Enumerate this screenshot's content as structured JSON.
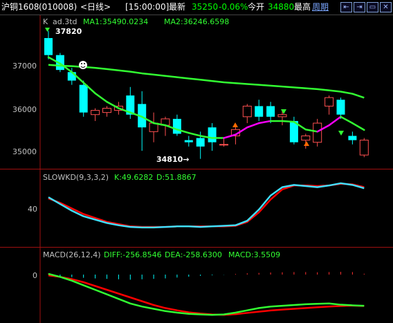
{
  "titlebar": {
    "instrument": "沪铜1608",
    "code": "(010008)",
    "period": "<日线>",
    "time": "[15:00:00]",
    "latest_label": "最新",
    "latest_value": "35250",
    "change_pct": "-0.06%",
    "open_label": "今开",
    "open_value": "34880",
    "high_label": "最高",
    "period_link": "周期",
    "buttons": [
      "⇤",
      "⇥",
      "▭",
      "✕"
    ]
  },
  "main_panel": {
    "header_k": "K",
    "header_ad": "ad.3td",
    "ma1_label": "MA1:35490.0234",
    "ma2_label": "MA2:36246.6598",
    "y_ticks": [
      "37000",
      "36000",
      "35000"
    ],
    "high_annotation": "37820",
    "low_annotation": "34810→",
    "colors": {
      "up": "#ff5050",
      "down": "#00ffff",
      "ma1": "#ff00ff",
      "ma2": "#32ff32"
    }
  },
  "kd_panel": {
    "title": "SLOWKD(9,3,3,2)",
    "k_label": "K:49.6282",
    "d_label": "D:51.8867",
    "y_tick": "40"
  },
  "macd_panel": {
    "title": "MACD(26,12,4)",
    "diff_label": "DIFF:-256.8546",
    "dea_label": "DEA:-258.6300",
    "macd_label": "MACD:3.5509",
    "y_tick": "0"
  },
  "chart_data": [
    {
      "type": "candlestick",
      "y_ticks": [
        37000,
        36000,
        35000
      ],
      "annotations": {
        "high": 37820,
        "low": 34810
      },
      "candles": [
        {
          "o": 37650,
          "h": 37820,
          "l": 37150,
          "c": 37250
        },
        {
          "o": 37250,
          "h": 37300,
          "l": 36850,
          "c": 36900
        },
        {
          "o": 36850,
          "h": 36950,
          "l": 36550,
          "c": 36650
        },
        {
          "o": 36550,
          "h": 36650,
          "l": 35800,
          "c": 35900
        },
        {
          "o": 35850,
          "h": 36000,
          "l": 35700,
          "c": 35950
        },
        {
          "o": 35900,
          "h": 36050,
          "l": 35800,
          "c": 36000
        },
        {
          "o": 35950,
          "h": 36150,
          "l": 35850,
          "c": 36050
        },
        {
          "o": 36300,
          "h": 36500,
          "l": 35750,
          "c": 35850
        },
        {
          "o": 36100,
          "h": 36400,
          "l": 35000,
          "c": 35550
        },
        {
          "o": 35450,
          "h": 35900,
          "l": 35200,
          "c": 35650
        },
        {
          "o": 35600,
          "h": 35800,
          "l": 35350,
          "c": 35750
        },
        {
          "o": 35750,
          "h": 35850,
          "l": 35350,
          "c": 35400
        },
        {
          "o": 35250,
          "h": 35350,
          "l": 35100,
          "c": 35200
        },
        {
          "o": 35300,
          "h": 35450,
          "l": 34810,
          "c": 35100
        },
        {
          "o": 35550,
          "h": 35650,
          "l": 35000,
          "c": 35200
        },
        {
          "o": 35150,
          "h": 35300,
          "l": 35100,
          "c": 35150
        },
        {
          "o": 35350,
          "h": 35600,
          "l": 35150,
          "c": 35500
        },
        {
          "o": 35800,
          "h": 36100,
          "l": 35650,
          "c": 36050
        },
        {
          "o": 36050,
          "h": 36200,
          "l": 35700,
          "c": 35800
        },
        {
          "o": 36050,
          "h": 36150,
          "l": 35650,
          "c": 35800
        },
        {
          "o": 35800,
          "h": 35950,
          "l": 35600,
          "c": 35850
        },
        {
          "o": 35700,
          "h": 35800,
          "l": 35150,
          "c": 35200
        },
        {
          "o": 35250,
          "h": 35400,
          "l": 35050,
          "c": 35350
        },
        {
          "o": 35200,
          "h": 35750,
          "l": 35100,
          "c": 35650
        },
        {
          "o": 36050,
          "h": 36300,
          "l": 35850,
          "c": 36250
        },
        {
          "o": 36200,
          "h": 36250,
          "l": 35750,
          "c": 35850
        },
        {
          "o": 35350,
          "h": 35450,
          "l": 35150,
          "c": 35250
        },
        {
          "o": 34900,
          "h": 35300,
          "l": 34850,
          "c": 35250
        }
      ],
      "ma1": [
        37200,
        37050,
        36850,
        36600,
        36350,
        36150,
        36000,
        35900,
        35800,
        35650,
        35600,
        35500,
        35420,
        35350,
        35300,
        35300,
        35380,
        35550,
        35650,
        35700,
        35700,
        35680,
        35500,
        35450,
        35600,
        35800,
        35650,
        35490
      ],
      "ma2": [
        37020,
        37000,
        36990,
        36970,
        36950,
        36920,
        36890,
        36860,
        36820,
        36790,
        36760,
        36730,
        36700,
        36670,
        36640,
        36610,
        36590,
        36570,
        36550,
        36530,
        36510,
        36490,
        36470,
        36450,
        36420,
        36390,
        36340,
        36247
      ]
    },
    {
      "type": "line",
      "y_ticks": [
        40
      ],
      "series": [
        {
          "name": "K",
          "values": [
            62,
            50,
            38,
            28,
            22,
            16,
            12,
            9,
            8,
            8,
            9,
            10,
            10,
            9,
            10,
            11,
            12,
            20,
            40,
            65,
            80,
            84,
            82,
            80,
            83,
            87,
            84,
            78
          ]
        },
        {
          "name": "D",
          "values": [
            60,
            52,
            42,
            32,
            25,
            18,
            14,
            10,
            9,
            9,
            9,
            10,
            10,
            10,
            10,
            10,
            11,
            18,
            35,
            58,
            76,
            83,
            83,
            82,
            83,
            86,
            85,
            80
          ]
        }
      ]
    },
    {
      "type": "bar+line",
      "y_ticks": [
        0
      ],
      "macd": [
        5,
        -8,
        -12,
        -15,
        -18,
        -20,
        -22,
        -24,
        -22,
        -20,
        -18,
        -14,
        -10,
        -6,
        -3,
        -1,
        3,
        6,
        8,
        10,
        11,
        12,
        12,
        11,
        12,
        13,
        12,
        4
      ],
      "series": [
        {
          "name": "DIFF",
          "values": [
            5,
            -15,
            -40,
            -70,
            -100,
            -130,
            -160,
            -190,
            -210,
            -225,
            -240,
            -250,
            -258,
            -262,
            -265,
            -262,
            -250,
            -235,
            -220,
            -210,
            -205,
            -200,
            -195,
            -192,
            -190,
            -198,
            -202,
            -205
          ]
        },
        {
          "name": "DEA",
          "values": [
            -5,
            -15,
            -30,
            -50,
            -75,
            -100,
            -125,
            -150,
            -175,
            -200,
            -220,
            -235,
            -248,
            -256,
            -262,
            -265,
            -260,
            -252,
            -244,
            -236,
            -230,
            -225,
            -220,
            -215,
            -210,
            -206,
            -204,
            -206
          ]
        }
      ]
    }
  ]
}
